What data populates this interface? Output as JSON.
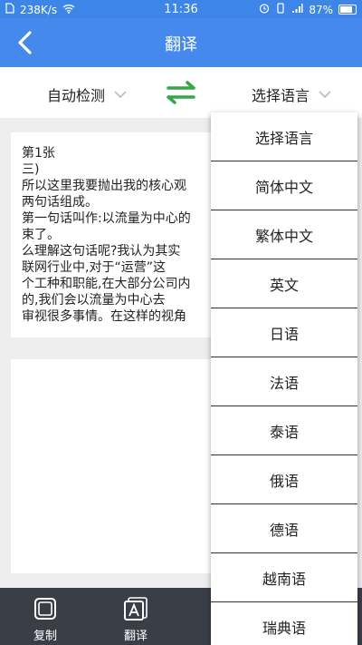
{
  "status_bar": {
    "speed": "238K/s",
    "time": "11:36",
    "battery": "87%"
  },
  "header": {
    "title": "翻译"
  },
  "language_bar": {
    "source": "自动检测",
    "target": "选择语言"
  },
  "source_text": "第1张\n三)\n所以这里我要抛出我的核心观\n两句话组成。\n第一句话叫作:以流量为中心的\n束了。\n么理解这句话呢?我认为其实\n联网行业中,对于“运营”这\n个工种和职能,在大部分公司内\n的,我们会以流量为中心去\n审视很多事情。在这样的视角",
  "dropdown": {
    "items": [
      "选择语言",
      "简体中文",
      "繁体中文",
      "英文",
      "日语",
      "法语",
      "泰语",
      "俄语",
      "德语",
      "越南语",
      "瑞典语"
    ]
  },
  "bottom_bar": {
    "copy_label": "复制",
    "translate_label": "翻译"
  },
  "colors": {
    "header": "#4689ec",
    "swap_arrows": "#35a845",
    "bottom_bar": "#3a3e47"
  }
}
